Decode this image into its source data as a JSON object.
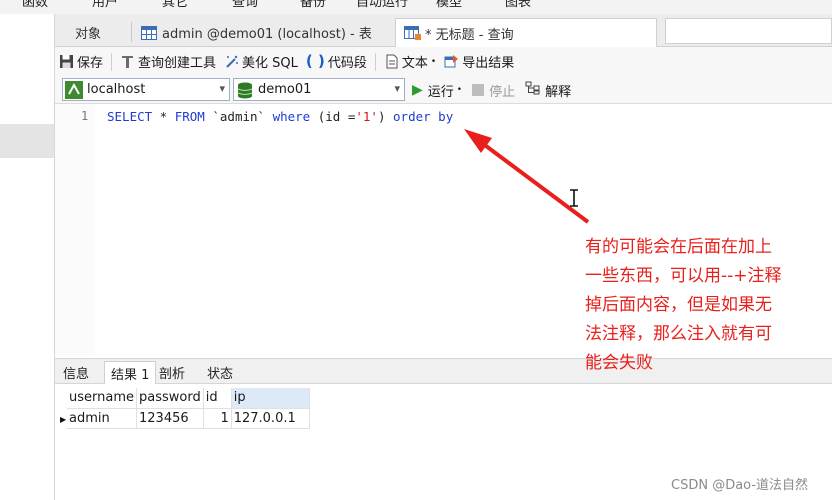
{
  "menu": [
    "函数",
    "用户",
    "其它",
    "查询",
    "备份",
    "自动运行",
    "模型",
    "图表"
  ],
  "tabs": {
    "objects": "对象",
    "table_tab": "admin @demo01 (localhost) - 表",
    "query_tab": "* 无标题 - 查询"
  },
  "toolbar": {
    "save": "保存",
    "query_builder": "查询创建工具",
    "beautify_sql": "美化 SQL",
    "code_snippet": "代码段",
    "text": "文本",
    "export_result": "导出结果"
  },
  "connection": {
    "server": "localhost",
    "database": "demo01",
    "run": "运行",
    "stop": "停止",
    "explain": "解释"
  },
  "editor": {
    "line_number": "1",
    "sql": {
      "select": "SELECT",
      "star": " * ",
      "from": "FROM",
      "table": " `admin` ",
      "where": "where",
      "cond_open": " (id =",
      "value": "'1'",
      "cond_close": ") ",
      "order_by": "order by"
    }
  },
  "result_tabs": [
    "信息",
    "结果 1",
    "剖析",
    "状态"
  ],
  "results": {
    "columns": [
      "username",
      "password",
      "id",
      "ip"
    ],
    "rows": [
      [
        "admin",
        "123456",
        "1",
        "127.0.0.1"
      ]
    ]
  },
  "annotation": [
    "有的可能会在后面在加上",
    "一些东西，可以用--+注释",
    "掉后面内容，但是如果无",
    "法注释，那么注入就有可",
    "能会失败"
  ],
  "watermark": "CSDN @Dao-道法自然",
  "colors": {
    "annotation": "#e8201c",
    "keyword": "#1f3bd6",
    "string": "#c71a1a"
  }
}
